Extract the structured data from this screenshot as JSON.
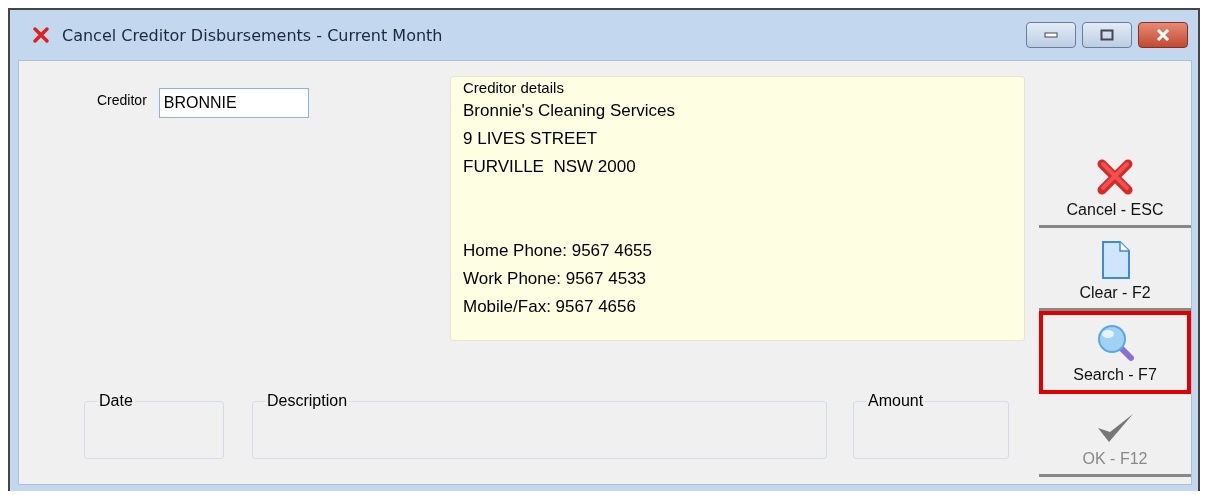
{
  "window": {
    "title": "Cancel Creditor Disbursements - Current Month"
  },
  "creditor": {
    "label": "Creditor",
    "value": "BRONNIE"
  },
  "details": {
    "title": "Creditor details",
    "address_lines": [
      "Bronnie's Cleaning Services",
      "9 LIVES STREET",
      "FURVILLE  NSW 2000"
    ],
    "phone_lines": [
      "Home Phone: 9567 4655",
      "Work Phone: 9567 4533",
      "Mobile/Fax: 9567 4656"
    ]
  },
  "groups": [
    {
      "label": "Date"
    },
    {
      "label": "Description"
    },
    {
      "label": "Amount"
    }
  ],
  "buttons": [
    {
      "kind": "cancel",
      "label": "Cancel - ESC",
      "disabled": false,
      "highlighted": false
    },
    {
      "kind": "clear",
      "label": "Clear - F2",
      "disabled": false,
      "highlighted": false
    },
    {
      "kind": "search",
      "label": "Search - F7",
      "disabled": false,
      "highlighted": true
    },
    {
      "kind": "ok",
      "label": "OK - F12",
      "disabled": true,
      "highlighted": false
    }
  ]
}
